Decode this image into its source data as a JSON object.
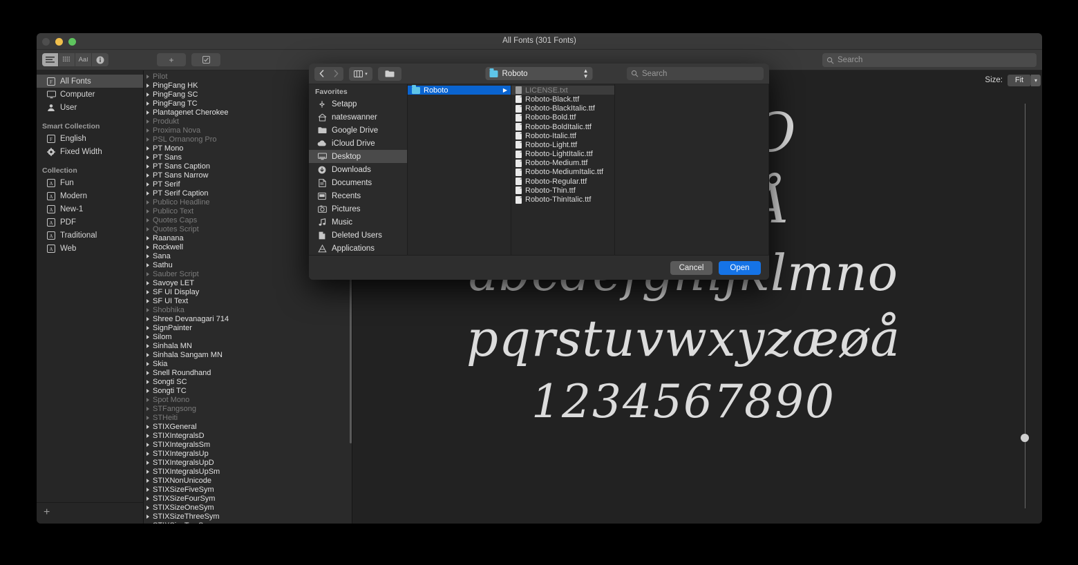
{
  "window": {
    "title": "All Fonts (301 Fonts)",
    "traffic": [
      "close",
      "minimize",
      "zoom"
    ],
    "toolbar": {
      "view_buttons": [
        {
          "name": "list-view",
          "glyph": "☰",
          "active": true
        },
        {
          "name": "grid-view",
          "glyph": "░",
          "active": false
        },
        {
          "name": "sample-view",
          "glyph": "AaI",
          "active": false
        },
        {
          "name": "info-view",
          "glyph": "ⓘ",
          "active": false
        }
      ],
      "add_label": "+",
      "validate_label": "☑",
      "search_placeholder": "Search",
      "search_value": ""
    }
  },
  "sidebar": {
    "top_items": [
      {
        "label": "All Fonts",
        "icon": "font-box-icon",
        "selected": true
      },
      {
        "label": "Computer",
        "icon": "monitor-icon",
        "selected": false
      },
      {
        "label": "User",
        "icon": "person-icon",
        "selected": false
      }
    ],
    "smart_collection_header": "Smart Collection",
    "smart_items": [
      {
        "label": "English",
        "icon": "font-box-icon"
      },
      {
        "label": "Fixed Width",
        "icon": "gear-icon"
      }
    ],
    "collection_header": "Collection",
    "collection_items": [
      {
        "label": "Fun",
        "icon": "a-box-icon"
      },
      {
        "label": "Modern",
        "icon": "a-box-icon"
      },
      {
        "label": "New-1",
        "icon": "a-box-icon"
      },
      {
        "label": "PDF",
        "icon": "a-box-icon"
      },
      {
        "label": "Traditional",
        "icon": "a-box-icon"
      },
      {
        "label": "Web",
        "icon": "a-box-icon"
      }
    ],
    "add_label": "+"
  },
  "font_list": [
    {
      "label": "Pilot",
      "dim": true
    },
    {
      "label": "PingFang HK",
      "dim": false
    },
    {
      "label": "PingFang SC",
      "dim": false
    },
    {
      "label": "PingFang TC",
      "dim": false
    },
    {
      "label": "Plantagenet Cherokee",
      "dim": false
    },
    {
      "label": "Produkt",
      "dim": true
    },
    {
      "label": "Proxima Nova",
      "dim": true
    },
    {
      "label": "PSL Ornanong Pro",
      "dim": true
    },
    {
      "label": "PT Mono",
      "dim": false
    },
    {
      "label": "PT Sans",
      "dim": false
    },
    {
      "label": "PT Sans Caption",
      "dim": false
    },
    {
      "label": "PT Sans Narrow",
      "dim": false
    },
    {
      "label": "PT Serif",
      "dim": false
    },
    {
      "label": "PT Serif Caption",
      "dim": false
    },
    {
      "label": "Publico Headline",
      "dim": true
    },
    {
      "label": "Publico Text",
      "dim": true
    },
    {
      "label": "Quotes Caps",
      "dim": true
    },
    {
      "label": "Quotes Script",
      "dim": true
    },
    {
      "label": "Raanana",
      "dim": false
    },
    {
      "label": "Rockwell",
      "dim": false
    },
    {
      "label": "Sana",
      "dim": false
    },
    {
      "label": "Sathu",
      "dim": false
    },
    {
      "label": "Sauber Script",
      "dim": true
    },
    {
      "label": "Savoye LET",
      "dim": false
    },
    {
      "label": "SF UI Display",
      "dim": false
    },
    {
      "label": "SF UI Text",
      "dim": false
    },
    {
      "label": "Shobhika",
      "dim": true
    },
    {
      "label": "Shree Devanagari 714",
      "dim": false
    },
    {
      "label": "SignPainter",
      "dim": false
    },
    {
      "label": "Silom",
      "dim": false
    },
    {
      "label": "Sinhala MN",
      "dim": false
    },
    {
      "label": "Sinhala Sangam MN",
      "dim": false
    },
    {
      "label": "Skia",
      "dim": false
    },
    {
      "label": "Snell Roundhand",
      "dim": false
    },
    {
      "label": "Songti SC",
      "dim": false
    },
    {
      "label": "Songti TC",
      "dim": false
    },
    {
      "label": "Spot Mono",
      "dim": true
    },
    {
      "label": "STFangsong",
      "dim": true
    },
    {
      "label": "STHeiti",
      "dim": true
    },
    {
      "label": "STIXGeneral",
      "dim": false
    },
    {
      "label": "STIXIntegralsD",
      "dim": false
    },
    {
      "label": "STIXIntegralsSm",
      "dim": false
    },
    {
      "label": "STIXIntegralsUp",
      "dim": false
    },
    {
      "label": "STIXIntegralsUpD",
      "dim": false
    },
    {
      "label": "STIXIntegralsUpSm",
      "dim": false
    },
    {
      "label": "STIXNonUnicode",
      "dim": false
    },
    {
      "label": "STIXSizeFiveSym",
      "dim": false
    },
    {
      "label": "STIXSizeFourSym",
      "dim": false
    },
    {
      "label": "STIXSizeOneSym",
      "dim": false
    },
    {
      "label": "STIXSizeThreeSym",
      "dim": false
    },
    {
      "label": "STIXSizeTwoSym",
      "dim": false
    }
  ],
  "preview": {
    "size_label": "Size:",
    "size_value": "Fit",
    "lines": [
      "KLMNO",
      "YZÆØÅ",
      "abcdefghijklmno",
      "pqrstuvwxyzæøå",
      "1234567890"
    ]
  },
  "dialog": {
    "toolbar": {
      "back_label": "‹",
      "forward_label": "›",
      "view_label": "⦀",
      "group_label": "folder-icon",
      "path_label": "Roboto",
      "search_placeholder": "Search",
      "search_value": ""
    },
    "favorites_header": "Favorites",
    "favorites": [
      {
        "label": "Setapp",
        "icon": "setapp-icon",
        "selected": false
      },
      {
        "label": "nateswanner",
        "icon": "home-icon",
        "selected": false
      },
      {
        "label": "Google Drive",
        "icon": "folder-icon",
        "selected": false
      },
      {
        "label": "iCloud Drive",
        "icon": "cloud-icon",
        "selected": false
      },
      {
        "label": "Desktop",
        "icon": "desktop-icon",
        "selected": true
      },
      {
        "label": "Downloads",
        "icon": "download-icon",
        "selected": false
      },
      {
        "label": "Documents",
        "icon": "documents-icon",
        "selected": false
      },
      {
        "label": "Recents",
        "icon": "recents-icon",
        "selected": false
      },
      {
        "label": "Pictures",
        "icon": "pictures-icon",
        "selected": false
      },
      {
        "label": "Music",
        "icon": "music-icon",
        "selected": false
      },
      {
        "label": "Deleted Users",
        "icon": "document-icon",
        "selected": false
      },
      {
        "label": "Applications",
        "icon": "applications-icon",
        "selected": false
      }
    ],
    "column1": [
      {
        "label": "Roboto",
        "icon": "folder-icon",
        "selected": true,
        "has_arrow": true
      }
    ],
    "column2": [
      {
        "label": "LICENSE.txt",
        "icon": "document-icon",
        "dim": true,
        "highlight": true
      },
      {
        "label": "Roboto-Black.ttf",
        "icon": "document-icon",
        "dim": false
      },
      {
        "label": "Roboto-BlackItalic.ttf",
        "icon": "document-icon",
        "dim": false
      },
      {
        "label": "Roboto-Bold.ttf",
        "icon": "document-icon",
        "dim": false
      },
      {
        "label": "Roboto-BoldItalic.ttf",
        "icon": "document-icon",
        "dim": false
      },
      {
        "label": "Roboto-Italic.ttf",
        "icon": "document-icon",
        "dim": false
      },
      {
        "label": "Roboto-Light.ttf",
        "icon": "document-icon",
        "dim": false
      },
      {
        "label": "Roboto-LightItalic.ttf",
        "icon": "document-icon",
        "dim": false
      },
      {
        "label": "Roboto-Medium.ttf",
        "icon": "document-icon",
        "dim": false
      },
      {
        "label": "Roboto-MediumItalic.ttf",
        "icon": "document-icon",
        "dim": false
      },
      {
        "label": "Roboto-Regular.ttf",
        "icon": "document-icon",
        "dim": false
      },
      {
        "label": "Roboto-Thin.ttf",
        "icon": "document-icon",
        "dim": false
      },
      {
        "label": "Roboto-ThinItalic.ttf",
        "icon": "document-icon",
        "dim": false
      }
    ],
    "cancel_label": "Cancel",
    "open_label": "Open"
  },
  "colors": {
    "accent_blue": "#1573e6",
    "selection_blue": "#0a64d0",
    "window_bg": "#2a2a2a",
    "titlebar_bg": "#3a3a3a",
    "text": "#e0e0e0",
    "text_dim": "#8a8a8a"
  }
}
